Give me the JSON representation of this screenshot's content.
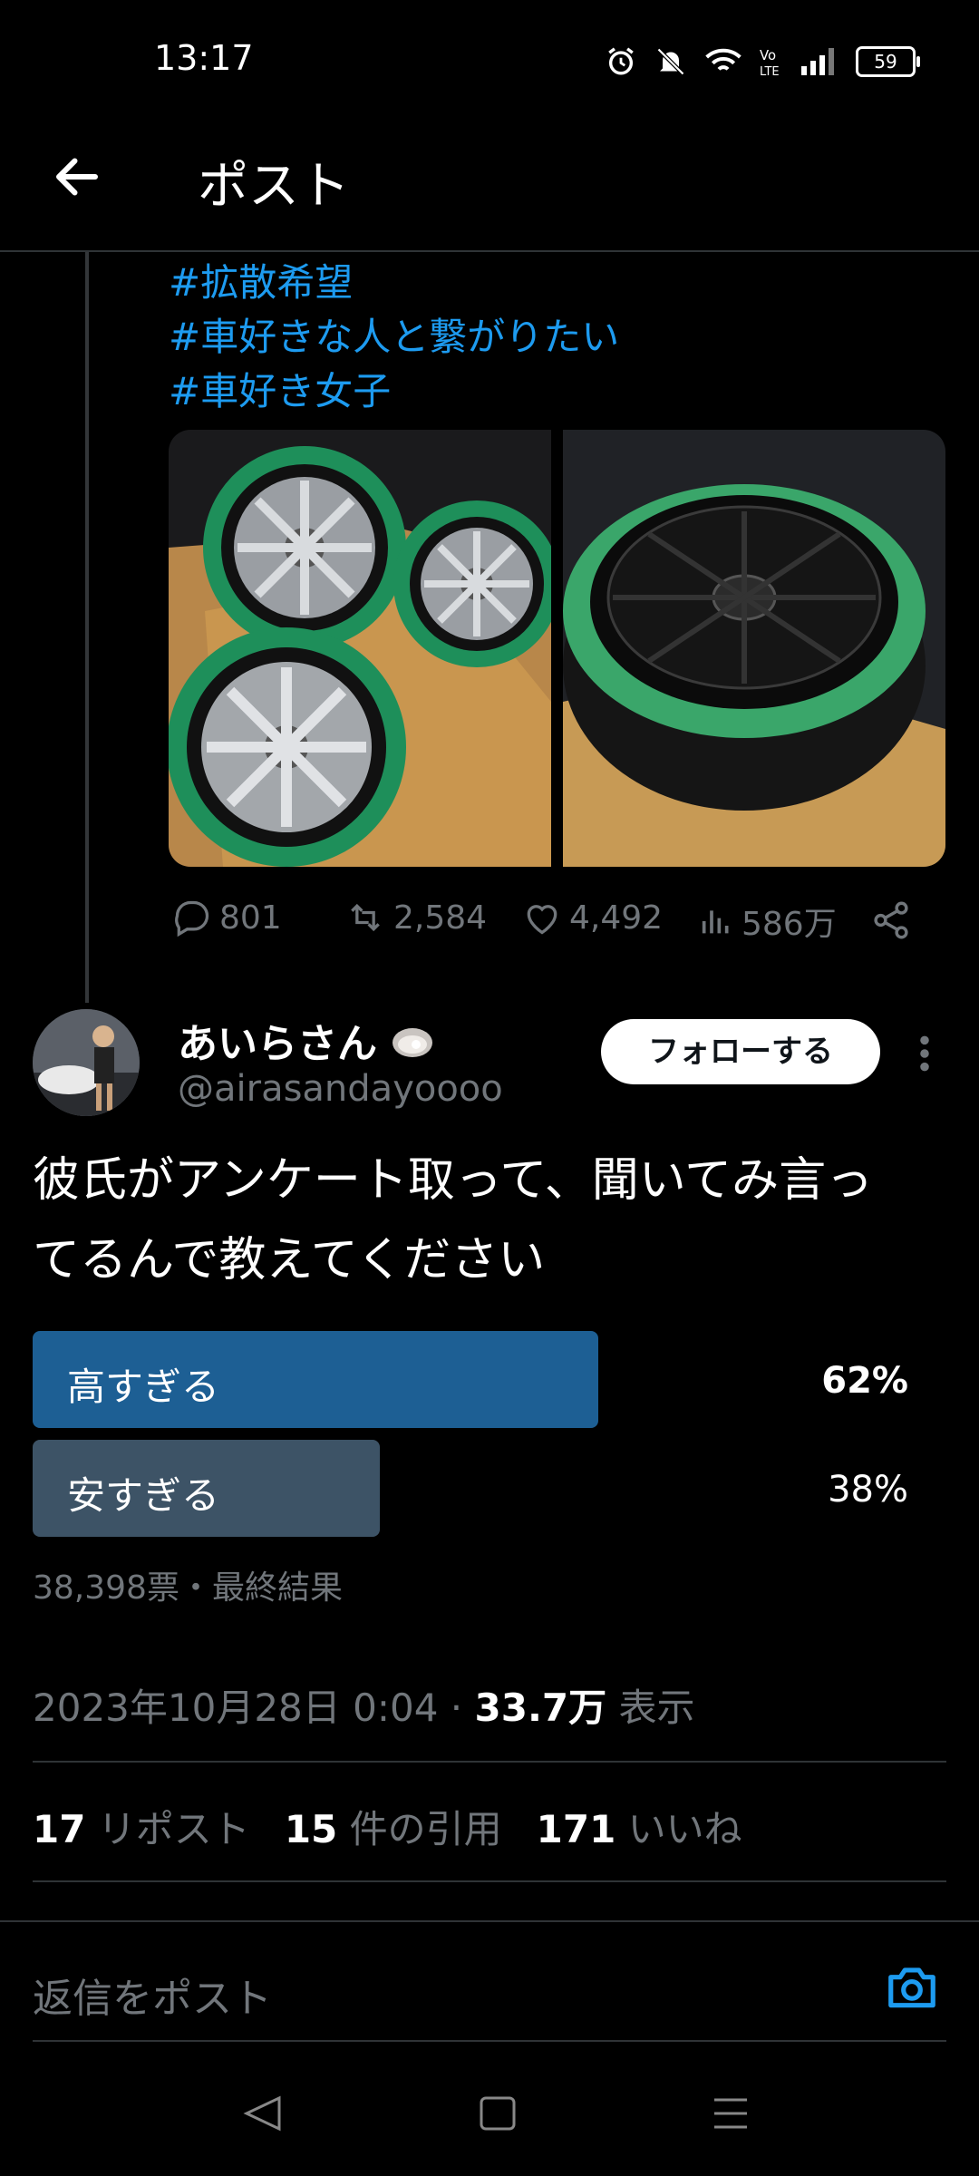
{
  "status_bar": {
    "time": "13:17",
    "battery": "59"
  },
  "header": {
    "title": "ポスト"
  },
  "previous_post": {
    "hashtags": [
      "#拡散希望",
      "#車好きな人と繋がりたい",
      "#車好き女子"
    ],
    "actions": {
      "replies": "801",
      "reposts": "2,584",
      "likes": "4,492",
      "views": "586万"
    }
  },
  "post": {
    "display_name": "あいらさん",
    "handle": "@airasandayoooo",
    "follow_label": "フォローする",
    "text_line1": "彼氏がアンケート取って、聞いてみ言っ",
    "text_line2": "てるんで教えてください",
    "poll": {
      "options": [
        {
          "label": "高すぎる",
          "percent": "62%",
          "fraction": 0.62
        },
        {
          "label": "安すぎる",
          "percent": "38%",
          "fraction": 0.38
        }
      ],
      "meta": "38,398票・最終結果"
    },
    "timestamp": "2023年10月28日 0:04 · ",
    "views_count": "33.7万",
    "views_label": " 表示",
    "stats": [
      {
        "count": "17",
        "label": " リポスト"
      },
      {
        "count": "15",
        "label": " 件の引用"
      },
      {
        "count": "171",
        "label": " いいね"
      }
    ]
  },
  "reply": {
    "placeholder": "返信をポスト"
  },
  "colors": {
    "accent": "#1d9bf0",
    "poll_winner": "#1d5f94",
    "poll_other": "#3d5366"
  }
}
